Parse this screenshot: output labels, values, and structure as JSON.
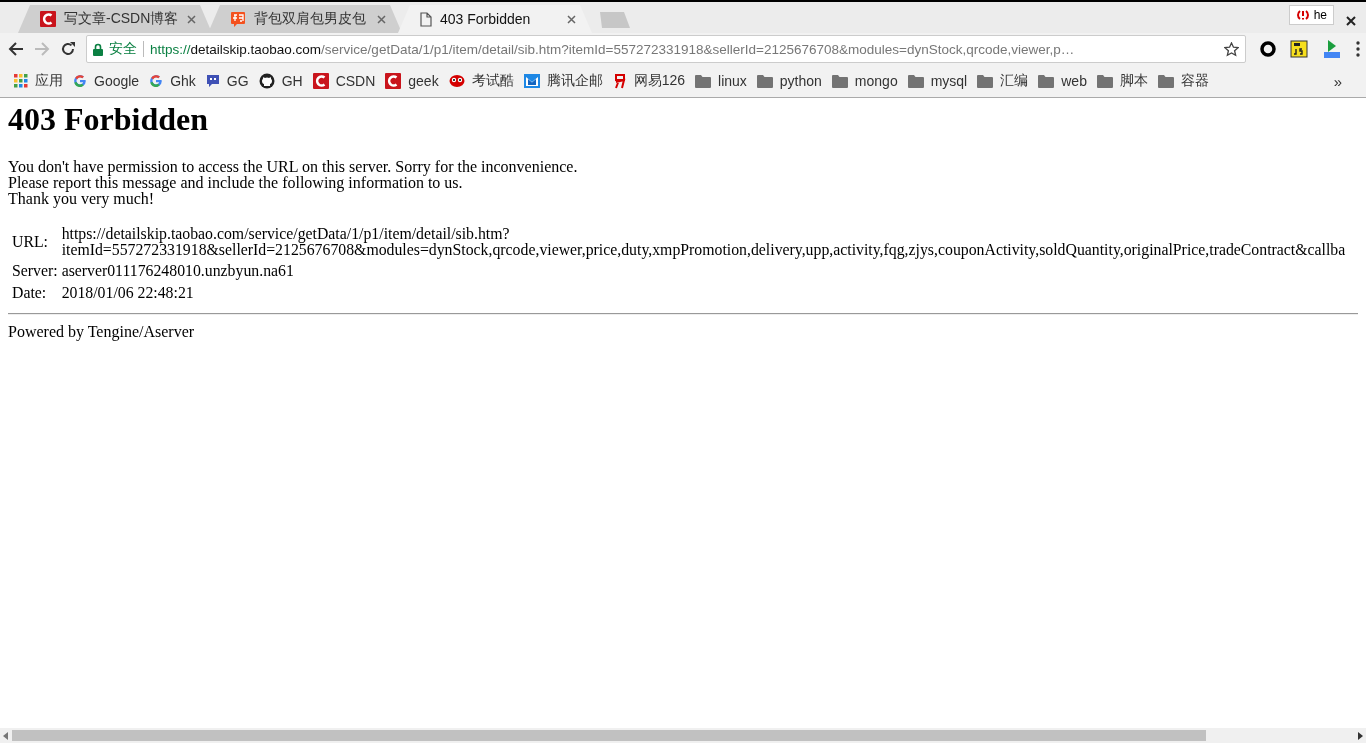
{
  "tabs": [
    {
      "title": "写文章-CSDN博客",
      "kind": "csdn",
      "selected": false
    },
    {
      "title": "背包双肩包男皮包",
      "kind": "taobao",
      "selected": false
    },
    {
      "title": "403 Forbidden",
      "kind": "page",
      "selected": true
    }
  ],
  "profile_badge": "he",
  "address_bar": {
    "secure_label": "安全",
    "scheme": "https://",
    "host": "detailskip.taobao.com",
    "path": "/service/getData/1/p1/item/detail/sib.htm?itemId=557272331918&sellerId=2125676708&modules=dynStock,qrcode,viewer,p…"
  },
  "bookmarks": [
    {
      "label": "应用",
      "kind": "apps"
    },
    {
      "label": "Google",
      "kind": "google"
    },
    {
      "label": "Ghk",
      "kind": "google"
    },
    {
      "label": "GG",
      "kind": "chat"
    },
    {
      "label": "GH",
      "kind": "github"
    },
    {
      "label": "CSDN",
      "kind": "csdn"
    },
    {
      "label": "geek",
      "kind": "csdn"
    },
    {
      "label": "考试酷",
      "kind": "eyes"
    },
    {
      "label": "腾讯企邮",
      "kind": "mail"
    },
    {
      "label": "网易126",
      "kind": "netease"
    },
    {
      "label": "linux",
      "kind": "folder"
    },
    {
      "label": "python",
      "kind": "folder"
    },
    {
      "label": "mongo",
      "kind": "folder"
    },
    {
      "label": "mysql",
      "kind": "folder"
    },
    {
      "label": "汇编",
      "kind": "folder"
    },
    {
      "label": "web",
      "kind": "folder"
    },
    {
      "label": "脚本",
      "kind": "folder"
    },
    {
      "label": "容器",
      "kind": "folder"
    }
  ],
  "bookmarks_overflow": "»",
  "page": {
    "heading": "403 Forbidden",
    "message_lines": [
      "You don't have permission to access the URL on this server. Sorry for the inconvenience.",
      "Please report this message and include the following information to us.",
      "Thank you very much!"
    ],
    "details": [
      {
        "label": "URL:",
        "value_lines": [
          "https://detailskip.taobao.com/service/getData/1/p1/item/detail/sib.htm?",
          "itemId=557272331918&sellerId=2125676708&modules=dynStock,qrcode,viewer,price,duty,xmpPromotion,delivery,upp,activity,fqg,zjys,couponActivity,soldQuantity,originalPrice,tradeContract&callba"
        ]
      },
      {
        "label": "Server:",
        "value_lines": [
          "aserver011176248010.unzbyun.na61"
        ]
      },
      {
        "label": "Date:",
        "value_lines": [
          "2018/01/06 22:48:21"
        ]
      }
    ],
    "footer": "Powered by Tengine/Aserver"
  }
}
